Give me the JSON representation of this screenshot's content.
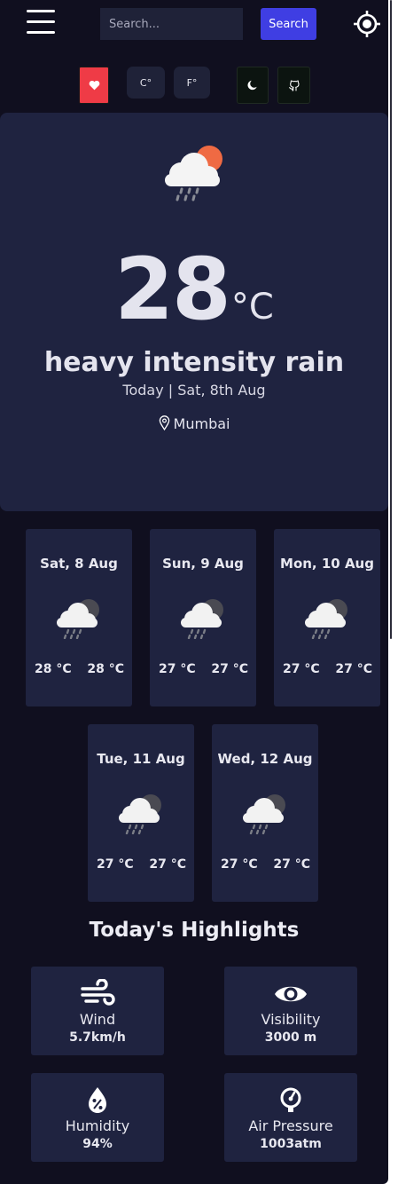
{
  "header": {
    "search_placeholder": "Search...",
    "search_button": "Search"
  },
  "controls": {
    "celsius_label": "C°",
    "fahrenheit_label": "F°"
  },
  "current": {
    "temp": "28",
    "unit": "°C",
    "condition": "heavy intensity rain",
    "date": "Today | Sat, 8th Aug",
    "location": "Mumbai",
    "icon": "rain-cloud-sun-icon"
  },
  "forecast": [
    {
      "day": "Sat, 8 Aug",
      "max": "28 °C",
      "min": "28 °C",
      "icon": "rain-cloud-icon"
    },
    {
      "day": "Sun, 9 Aug",
      "max": "27 °C",
      "min": "27 °C",
      "icon": "rain-cloud-icon"
    },
    {
      "day": "Mon, 10 Aug",
      "max": "27 °C",
      "min": "27 °C",
      "icon": "rain-cloud-icon"
    },
    {
      "day": "Tue, 11 Aug",
      "max": "27 °C",
      "min": "27 °C",
      "icon": "rain-cloud-icon"
    },
    {
      "day": "Wed, 12 Aug",
      "max": "27 °C",
      "min": "27 °C",
      "icon": "rain-cloud-icon"
    }
  ],
  "highlights": {
    "title": "Today's Highlights",
    "items": [
      {
        "label": "Wind",
        "value": "5.7km/h",
        "icon": "wind-icon"
      },
      {
        "label": "Visibility",
        "value": "3000 m",
        "icon": "eye-icon"
      },
      {
        "label": "Humidity",
        "value": "94%",
        "icon": "humidity-drop-icon"
      },
      {
        "label": "Air Pressure",
        "value": "1003atm",
        "icon": "pressure-gauge-icon"
      }
    ]
  },
  "colors": {
    "background": "#100f1f",
    "card": "#1f2340",
    "accent": "#3f3ee3",
    "favorite": "#ef3b46"
  }
}
